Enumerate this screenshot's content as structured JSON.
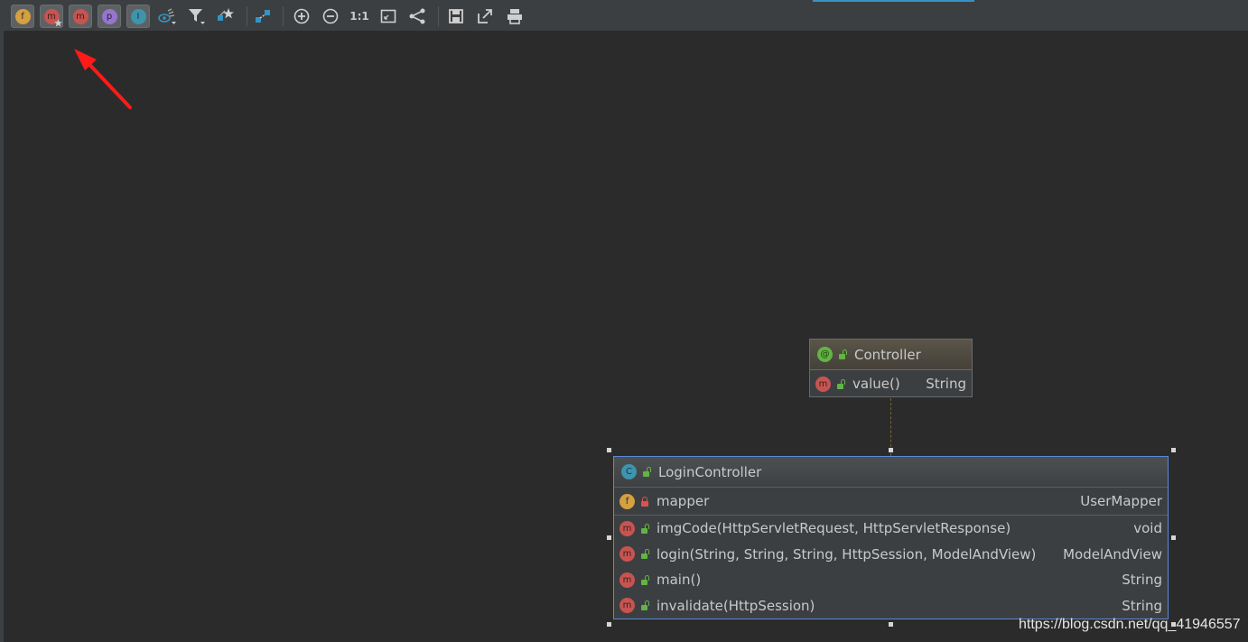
{
  "toolbar": {
    "toggles": [
      {
        "name": "show-fields-icon",
        "glyph": "f"
      },
      {
        "name": "show-constructors-icon",
        "glyph": "m"
      },
      {
        "name": "show-methods-icon",
        "glyph": "m"
      },
      {
        "name": "show-properties-icon",
        "glyph": "p"
      },
      {
        "name": "show-inner-classes-icon",
        "glyph": "I"
      }
    ],
    "actual_size_label": "1:1"
  },
  "annotation_node": {
    "badge": "@",
    "name": "Controller",
    "members": [
      {
        "badge": "m",
        "name": "value()",
        "type": "String"
      }
    ]
  },
  "class_node": {
    "badge": "C",
    "name": "LoginController",
    "fields": [
      {
        "badge": "f",
        "name": "mapper",
        "type": "UserMapper",
        "visibility": "private"
      }
    ],
    "methods": [
      {
        "badge": "m",
        "name": "imgCode(HttpServletRequest, HttpServletResponse)",
        "type": "void"
      },
      {
        "badge": "m",
        "name": "login(String, String, String, HttpSession, ModelAndView)",
        "type": "ModelAndView"
      },
      {
        "badge": "m",
        "name": "main()",
        "type": "String"
      },
      {
        "badge": "m",
        "name": "invalidate(HttpSession)",
        "type": "String"
      }
    ]
  },
  "watermark": "https://blog.csdn.net/qq_41946557",
  "colors": {
    "background": "#2b2b2b",
    "toolbar": "#3c3f41",
    "selection_border": "#5a89d6",
    "annotation_arrow": "#ff2020"
  }
}
